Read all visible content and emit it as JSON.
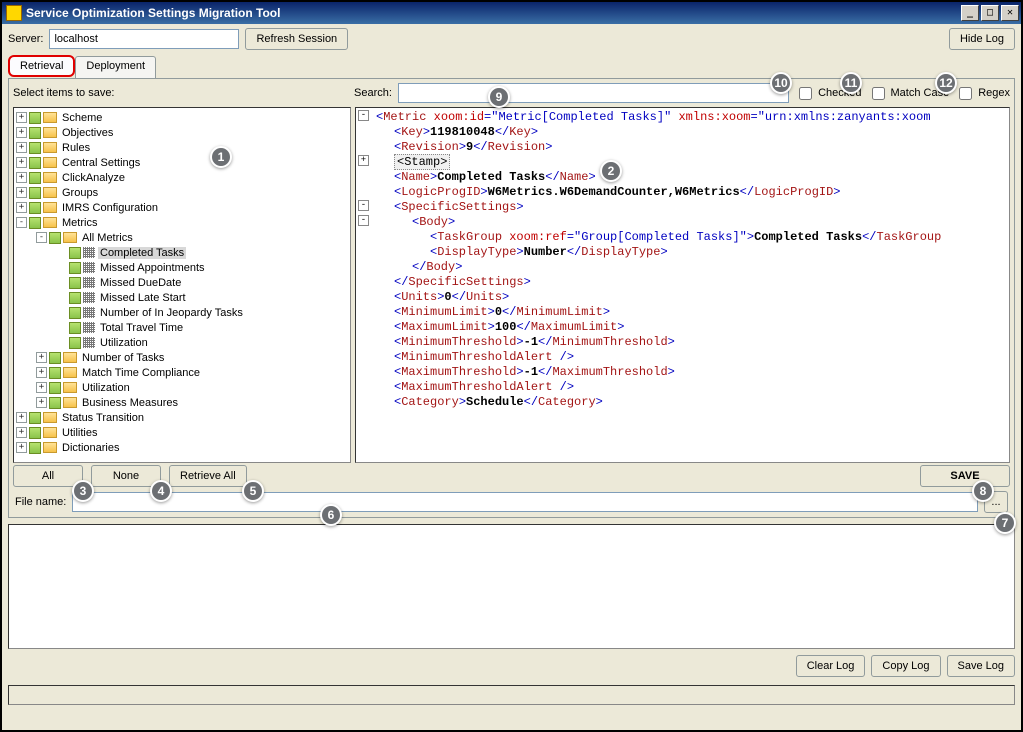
{
  "window": {
    "title": "Service Optimization Settings Migration Tool"
  },
  "toolbar": {
    "server_label": "Server:",
    "server_value": "localhost",
    "refresh_btn": "Refresh Session",
    "hide_log_btn": "Hide Log"
  },
  "tabs": {
    "retrieval": "Retrieval",
    "deployment": "Deployment"
  },
  "topline": {
    "select_label": "Select items to save:",
    "search_label": "Search:",
    "search_value": "",
    "checked_label": "Checked",
    "matchcase_label": "Match Case",
    "regex_label": "Regex"
  },
  "tree": [
    {
      "depth": 0,
      "toggle": "+",
      "type": "folder",
      "label": "Scheme"
    },
    {
      "depth": 0,
      "toggle": "+",
      "type": "folder",
      "label": "Objectives"
    },
    {
      "depth": 0,
      "toggle": "+",
      "type": "folder",
      "label": "Rules"
    },
    {
      "depth": 0,
      "toggle": "+",
      "type": "folder",
      "label": "Central Settings"
    },
    {
      "depth": 0,
      "toggle": "+",
      "type": "folder",
      "label": "ClickAnalyze"
    },
    {
      "depth": 0,
      "toggle": "+",
      "type": "folder",
      "label": "Groups"
    },
    {
      "depth": 0,
      "toggle": "+",
      "type": "folder",
      "label": "IMRS Configuration"
    },
    {
      "depth": 0,
      "toggle": "-",
      "type": "folder",
      "label": "Metrics"
    },
    {
      "depth": 1,
      "toggle": "-",
      "type": "folder",
      "label": "All Metrics"
    },
    {
      "depth": 2,
      "toggle": "",
      "type": "leaf",
      "label": "Completed Tasks",
      "selected": true
    },
    {
      "depth": 2,
      "toggle": "",
      "type": "leaf",
      "label": "Missed Appointments"
    },
    {
      "depth": 2,
      "toggle": "",
      "type": "leaf",
      "label": "Missed DueDate"
    },
    {
      "depth": 2,
      "toggle": "",
      "type": "leaf",
      "label": "Missed Late Start"
    },
    {
      "depth": 2,
      "toggle": "",
      "type": "leaf",
      "label": "Number of In Jeopardy Tasks"
    },
    {
      "depth": 2,
      "toggle": "",
      "type": "leaf",
      "label": "Total Travel Time"
    },
    {
      "depth": 2,
      "toggle": "",
      "type": "leaf",
      "label": "Utilization"
    },
    {
      "depth": 1,
      "toggle": "+",
      "type": "folder",
      "label": "Number of Tasks"
    },
    {
      "depth": 1,
      "toggle": "+",
      "type": "folder",
      "label": "Match Time Compliance"
    },
    {
      "depth": 1,
      "toggle": "+",
      "type": "folder",
      "label": "Utilization"
    },
    {
      "depth": 1,
      "toggle": "+",
      "type": "folder",
      "label": "Business Measures"
    },
    {
      "depth": 0,
      "toggle": "+",
      "type": "folder",
      "label": "Status Transition"
    },
    {
      "depth": 0,
      "toggle": "+",
      "type": "folder",
      "label": "Utilities"
    },
    {
      "depth": 0,
      "toggle": "+",
      "type": "folder",
      "label": "Dictionaries"
    }
  ],
  "xml": {
    "metric_id_attr": "xoom:id",
    "metric_id_val": "\"Metric[Completed Tasks]\"",
    "xmlns_attr": "xmlns:xoom",
    "xmlns_val": "\"urn:xmlns:zanyants:xoom",
    "key_val": "119810048",
    "revision_val": "9",
    "name_val": "Completed Tasks",
    "logic_val": "W6Metrics.W6DemandCounter,W6Metrics",
    "taskgroup_attr": "xoom:ref",
    "taskgroup_val": "\"Group[Completed Tasks]\"",
    "taskgroup_text": "Completed Tasks",
    "display_val": "Number",
    "units_val": "0",
    "minlimit_val": "0",
    "maxlimit_val": "100",
    "minthresh_val": "-1",
    "maxthresh_val": "-1",
    "category_val": "Schedule"
  },
  "buttons": {
    "all": "All",
    "none": "None",
    "retrieve_all": "Retrieve All",
    "save": "SAVE"
  },
  "file": {
    "label": "File name:",
    "value": "",
    "browse": "..."
  },
  "log_buttons": {
    "clear": "Clear Log",
    "copy": "Copy Log",
    "save": "Save Log"
  },
  "callouts": {
    "1": "1",
    "2": "2",
    "3": "3",
    "4": "4",
    "5": "5",
    "6": "6",
    "7": "7",
    "8": "8",
    "9": "9",
    "10": "10",
    "11": "11",
    "12": "12"
  }
}
